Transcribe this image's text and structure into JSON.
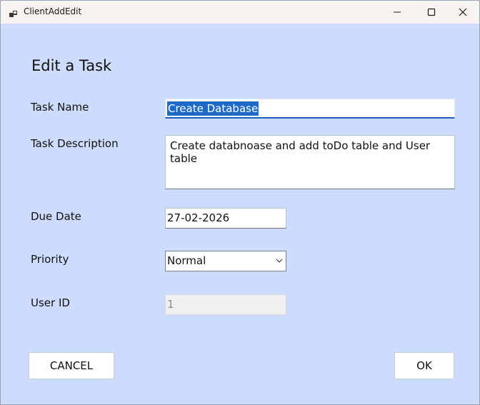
{
  "window": {
    "title": "ClientAddEdit",
    "icon": "app-window-icon"
  },
  "titlebar_controls": [
    "minimize-icon",
    "maximize-icon",
    "close-icon"
  ],
  "form": {
    "heading": "Edit a Task",
    "task_name": {
      "label": "Task Name",
      "value": "Create Database",
      "selected": true
    },
    "task_description": {
      "label": "Task Description",
      "value": "Create databnoase and add toDo table and User table"
    },
    "due_date": {
      "label": "Due Date",
      "value": "27-02-2026"
    },
    "priority": {
      "label": "Priority",
      "value": "Normal"
    },
    "user_id": {
      "label": "User ID",
      "value": "1",
      "disabled": true
    }
  },
  "buttons": {
    "cancel": "CANCEL",
    "ok": "OK"
  },
  "colors": {
    "background": "#cddbfd",
    "selection": "#1e6ac6",
    "focus_underline": "#1c5fb8"
  }
}
